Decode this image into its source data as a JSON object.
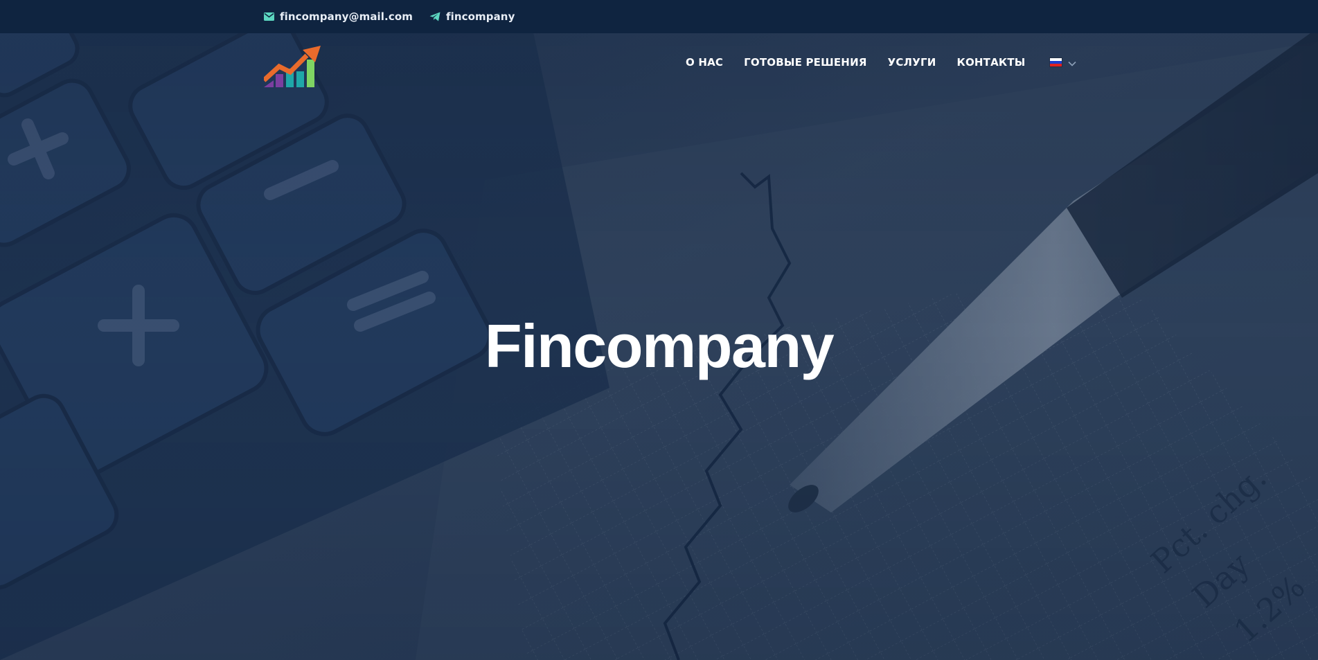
{
  "topbar": {
    "email": "fincompany@mail.com",
    "telegram": "fincompany",
    "email_icon": "envelope-icon",
    "telegram_icon": "telegram-plane-icon"
  },
  "logo": {
    "icon": "growth-chart-logo-icon"
  },
  "nav": {
    "items": [
      {
        "label": "О НАС"
      },
      {
        "label": "ГОТОВЫЕ РЕШЕНИЯ"
      },
      {
        "label": "УСЛУГИ"
      },
      {
        "label": "КОНТАКТЫ"
      }
    ],
    "language": {
      "flag_icon": "russia-flag-icon",
      "chevron_icon": "chevron-down-icon"
    }
  },
  "hero": {
    "title": "Fincompany"
  },
  "colors": {
    "topbar_bg": "#0f2440",
    "accent_teal": "#5cd6c0",
    "logo_orange": "#e96b2c",
    "logo_purple": "#7b3fa0",
    "logo_teal": "#1fa7a8",
    "logo_green": "#7fd463"
  }
}
